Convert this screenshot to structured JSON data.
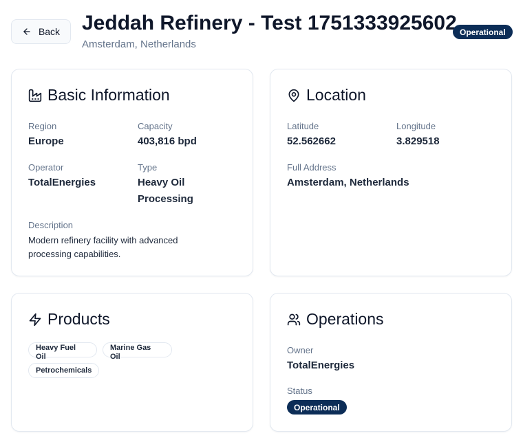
{
  "header": {
    "back_label": "Back",
    "title": "Jeddah Refinery - Test 1751333925602",
    "subtitle": "Amsterdam, Netherlands",
    "status_badge": "Operational"
  },
  "basic_info": {
    "title": "Basic Information",
    "icon": "factory-icon",
    "region_label": "Region",
    "region_value": "Europe",
    "capacity_label": "Capacity",
    "capacity_value": "403,816 bpd",
    "operator_label": "Operator",
    "operator_value": "TotalEnergies",
    "type_label": "Type",
    "type_value_line1": "Heavy Oil",
    "type_value_line2": "Processing",
    "description_label": "Description",
    "description_line1": "Modern refinery facility with advanced",
    "description_line2": "processing capabilities."
  },
  "location": {
    "title": "Location",
    "icon": "map-pin-icon",
    "latitude_label": "Latitude",
    "latitude_value": "52.562662",
    "longitude_label": "Longitude",
    "longitude_value": "3.829518",
    "address_label": "Full Address",
    "address_value": "Amsterdam, Netherlands"
  },
  "products": {
    "title": "Products",
    "icon": "zap-icon",
    "items": [
      {
        "line1": "Heavy Fuel",
        "line2": "Oil"
      },
      {
        "line1": "Marine Gas",
        "line2": "Oil"
      },
      {
        "line1": "Petrochemicals",
        "line2": ""
      }
    ]
  },
  "operations": {
    "title": "Operations",
    "icon": "users-icon",
    "owner_label": "Owner",
    "owner_value": "TotalEnergies",
    "status_label": "Status",
    "status_value": "Operational"
  },
  "colors": {
    "badge_bg": "#0c2d57",
    "text_primary": "#0f172a",
    "text_muted": "#64748b",
    "border": "#e2e8f0"
  }
}
